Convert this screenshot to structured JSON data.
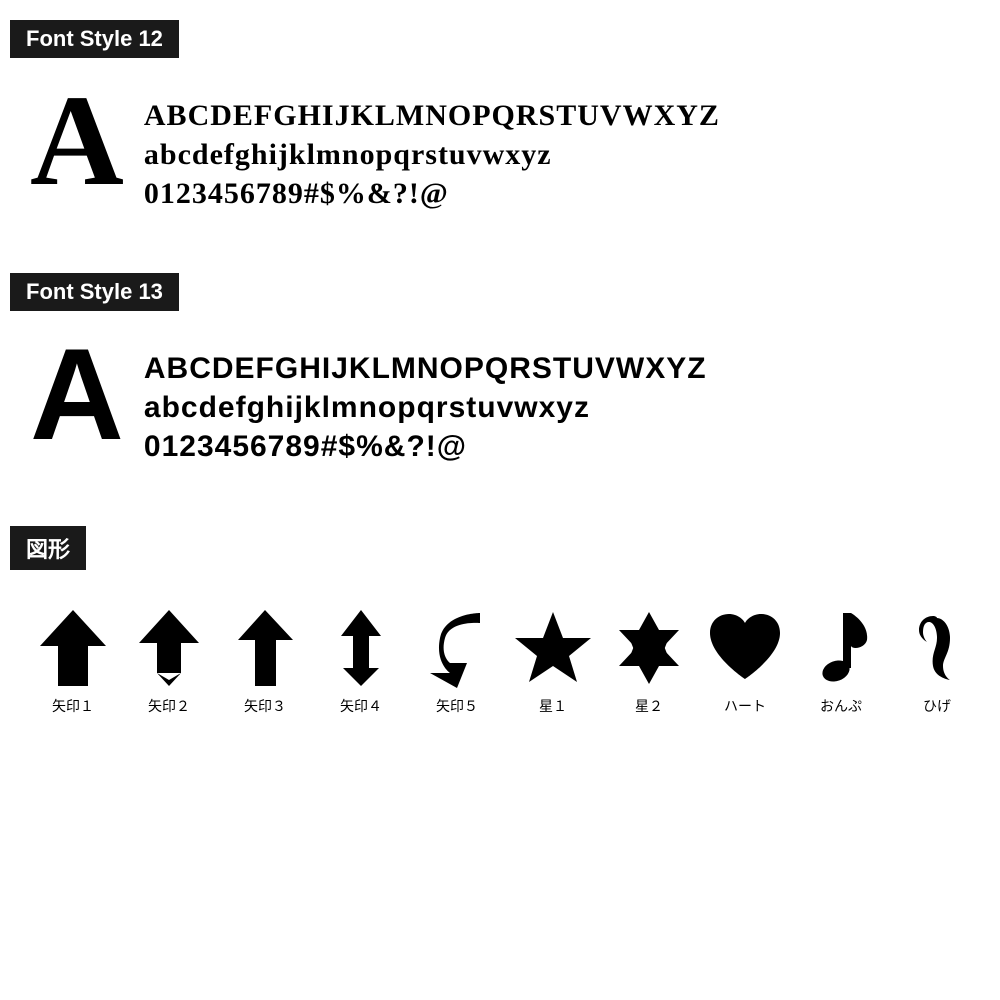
{
  "fontStyle12": {
    "label": "Font Style 12",
    "bigLetter": "A",
    "lines": [
      "ABCDEFGHIJKLMNOPQRSTUVWXYZ",
      "abcdefghijklmnopqrstuvwxyz",
      "0123456789#$%&?!@"
    ]
  },
  "fontStyle13": {
    "label": "Font Style 13",
    "bigLetter": "A",
    "lines": [
      "ABCDEFGHIJKLMNOPQRSTUVWXYZ",
      "abcdefghijklmnopqrstuvwxyz",
      "0123456789#$%&?!@"
    ]
  },
  "shapes": {
    "label": "図形",
    "items": [
      {
        "name": "矢印１",
        "type": "arrow1"
      },
      {
        "name": "矢印２",
        "type": "arrow2"
      },
      {
        "name": "矢印３",
        "type": "arrow3"
      },
      {
        "name": "矢印４",
        "type": "arrow4"
      },
      {
        "name": "矢印５",
        "type": "arrow5"
      },
      {
        "name": "星１",
        "type": "star1"
      },
      {
        "name": "星２",
        "type": "star2"
      },
      {
        "name": "ハート",
        "type": "heart"
      },
      {
        "name": "おんぷ",
        "type": "note"
      },
      {
        "name": "ひげ",
        "type": "mustache"
      }
    ]
  }
}
